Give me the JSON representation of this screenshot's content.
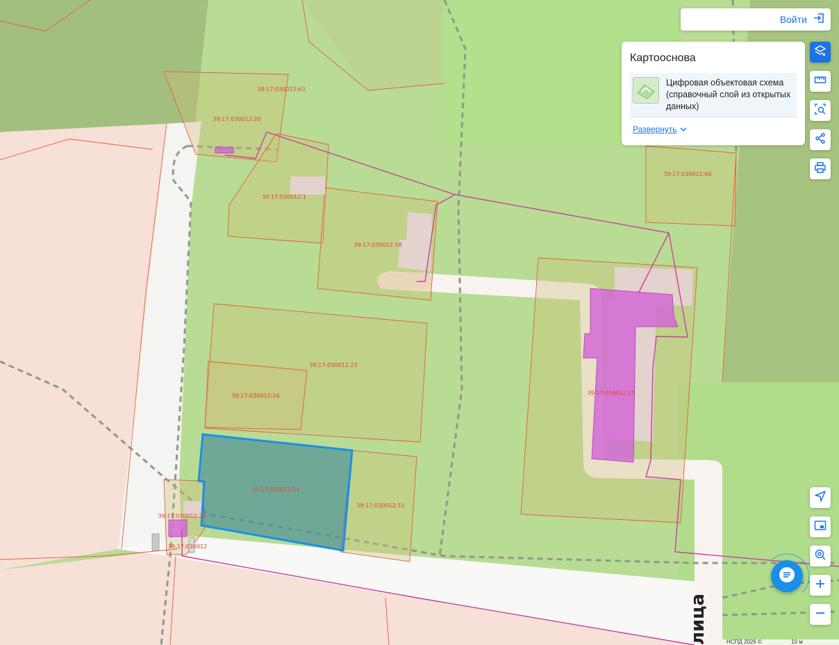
{
  "header": {
    "login_label": "Войти"
  },
  "layers_panel": {
    "title": "Картооснова",
    "layer_name": "Цифровая объектовая схема (справочный слой из открытых данных)",
    "expand_label": "Развернуть"
  },
  "map": {
    "street_label": "лица",
    "copyright": "НСПД 2026 ©",
    "scale": "10 м",
    "parcels": [
      "39:17:030012:63",
      "39:17:030012:20",
      "39:17:030012:60",
      "39:17:030012:1",
      "39:17:030012:18",
      "39:17:030012:23",
      "39:17:030012:16",
      "39:17:030012:19",
      "39:17:030012:24",
      "39:17:030012:15",
      "39:17:030012:22",
      "39:17:030012"
    ],
    "selected_parcel": "39:17:030012:24",
    "colors": {
      "parcel_outline": "#e85a3a",
      "building": "#c85ad0",
      "selection": "#1a8fe8",
      "contour": "#c8409c"
    }
  },
  "toolbar": {
    "icons": [
      "layers-icon",
      "ruler-icon",
      "area-select-icon",
      "share-icon",
      "print-icon"
    ],
    "map_controls": [
      "locate-icon",
      "minimap-icon",
      "geo-search-icon",
      "zoom-in-icon",
      "zoom-out-icon"
    ]
  },
  "colors": {
    "accent": "#1a73e8"
  }
}
